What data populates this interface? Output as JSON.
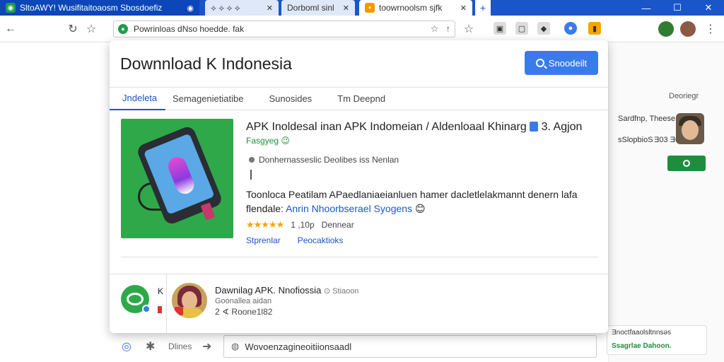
{
  "browser": {
    "tabs": [
      {
        "label": "SltoAWY! Wusifitaitoaosm Sbosdoefiz"
      },
      {
        "label": "⟡ ⟡ ⟡ ⟡"
      },
      {
        "label": "Dorboml sinl"
      },
      {
        "label": "toowrnoolsm sjfk"
      }
    ],
    "url": "Powrinloas dNso hoedde. fak"
  },
  "card": {
    "title": "Downnload K Indonesia",
    "search_label": "Snoodeilt",
    "tabs": [
      {
        "label": "Jndeleta"
      },
      {
        "label": "Semagenietiatibe"
      },
      {
        "label": "Sunosides"
      },
      {
        "label": "Tm Deepnd"
      }
    ],
    "app": {
      "title": "APK Inoldesal inan APK Indomeian / Aldenloaal Khinarg",
      "title_suffix": "3.  Agjon",
      "developer": "Fasgyeg",
      "subtitle": "Donhernasseslic Deolibes iss Nenlan",
      "description_line1": "Toonloca Peatilam APaedlaniaeianluen  hamer dacletlelakmannt denern lafa",
      "description_line2_prefix": "flendale: ",
      "description_line2_link": "Anrin Nhoorbserael Syogens",
      "rating_value": "1 ,10ƿ",
      "rating_label": "Dennear",
      "link_1": "Stprenlar",
      "link_2": "Peocaktioks"
    },
    "footer": {
      "k_label": "K",
      "name": "Dawnilag APK. Nnofiossia",
      "name_meta": "Stiaoon",
      "subtitle": "Goonallea aidan",
      "number": "2 ∢ Roone1l82"
    }
  },
  "right_panel": {
    "label": "Deoriegr",
    "line1": "Sardfnp, Theese",
    "line2": "sSlopbioS",
    "line3": "Ǝ03 Ǝ0S",
    "bottom_text": "Ǝnoctfaaolsltnnsǝs",
    "bottom_green": "Ssagrlae Dahoon."
  },
  "bottom_bar": {
    "label": "Dlines",
    "input_text": "Wovoenzagineoitiionsaadl"
  },
  "colors": {
    "accent": "#3a7bec",
    "tab_bar": "#1a56c8",
    "app_green": "#2fa84a",
    "link": "#1a56c8",
    "star": "#f2a600"
  }
}
